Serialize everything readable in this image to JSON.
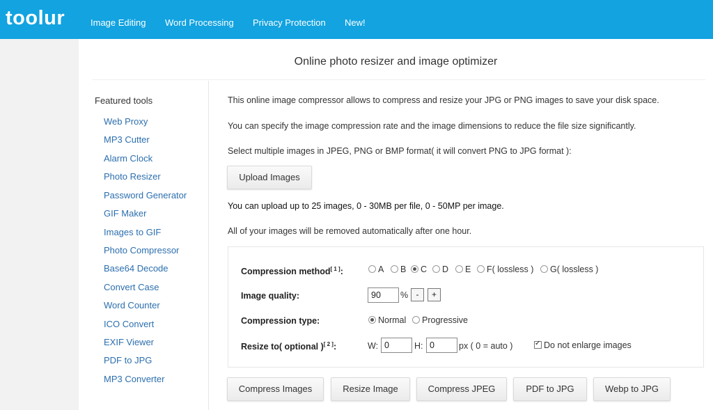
{
  "header": {
    "logo": "toolur",
    "nav": [
      "Image Editing",
      "Word Processing",
      "Privacy Protection",
      "New!"
    ]
  },
  "page": {
    "title": "Online photo resizer and image optimizer"
  },
  "sidebar": {
    "heading": "Featured tools",
    "items": [
      "Web Proxy",
      "MP3 Cutter",
      "Alarm Clock",
      "Photo Resizer",
      "Password Generator",
      "GIF Maker",
      "Images to GIF",
      "Photo Compressor",
      "Base64 Decode",
      "Convert Case",
      "Word Counter",
      "ICO Convert",
      "EXIF Viewer",
      "PDF to JPG",
      "MP3 Converter"
    ]
  },
  "main": {
    "intro1": "This online image compressor allows to compress and resize your JPG or PNG images to save your disk space.",
    "intro2": "You can specify the image compression rate and the image dimensions to reduce the file size significantly.",
    "intro3": "Select multiple images in JPEG, PNG or BMP format( it will convert PNG to JPG format ):",
    "upload_label": "Upload Images",
    "limits": "You can upload up to 25 images, 0 - 30MB per file, 0 - 50MP per image.",
    "removal": "All of your images will be removed automatically after one hour."
  },
  "options": {
    "method_label": "Compression method",
    "method_note": "[ 1 ]",
    "method_colon": ":",
    "methods": [
      "A",
      "B",
      "C",
      "D",
      "E",
      "F( lossless )",
      "G( lossless )"
    ],
    "method_selected": "C",
    "quality_label": "Image quality:",
    "quality_value": "90",
    "quality_unit": "%",
    "quality_minus": "-",
    "quality_plus": "+",
    "type_label": "Compression type:",
    "types": [
      "Normal",
      "Progressive"
    ],
    "type_selected": "Normal",
    "resize_label": "Resize to( optional )",
    "resize_note": "[ 2 ]",
    "resize_colon": ":",
    "width_label": "W:",
    "width_value": "0",
    "height_label": "H:",
    "height_value": "0",
    "px_note": "px ( 0 = auto )",
    "no_enlarge_label": "Do not enlarge images",
    "no_enlarge_checked": true
  },
  "actions": [
    "Compress Images",
    "Resize Image",
    "Compress JPEG",
    "PDF to JPG",
    "Webp to JPG"
  ],
  "colors": {
    "header_bg": "#12a3e0",
    "link": "#2c6fae"
  }
}
